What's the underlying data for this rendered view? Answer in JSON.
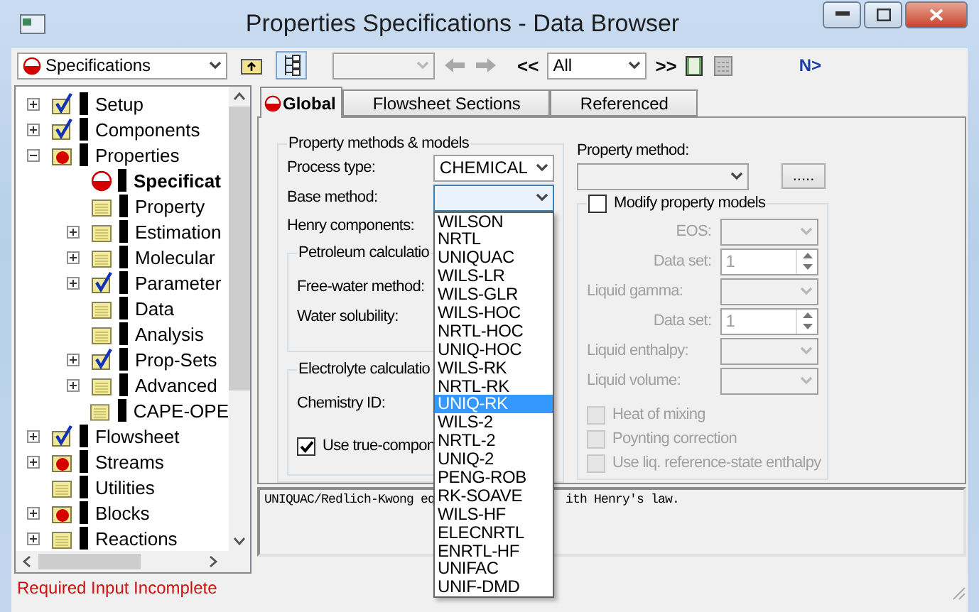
{
  "window": {
    "title": "Properties Specifications - Data Browser"
  },
  "toolbar": {
    "form_select": "Specifications",
    "prev_label": "<<",
    "section_select": "All",
    "next_label": ">>",
    "next_input": "N>"
  },
  "tree": [
    {
      "label": "Setup",
      "kind": "done",
      "expanded": false,
      "selected": false
    },
    {
      "label": "Components",
      "kind": "done",
      "expanded": false,
      "selected": false
    },
    {
      "label": "Properties",
      "kind": "incomplete",
      "expanded": true,
      "selected": false,
      "children": [
        {
          "label": "Specificat",
          "kind": "input",
          "selected": true
        },
        {
          "label": "Property",
          "kind": "empty",
          "selected": false
        },
        {
          "label": "Estimation",
          "kind": "empty",
          "expanded": false,
          "selected": false
        },
        {
          "label": "Molecular",
          "kind": "empty",
          "expanded": false,
          "selected": false
        },
        {
          "label": "Parameter",
          "kind": "done",
          "expanded": false,
          "selected": false
        },
        {
          "label": "Data",
          "kind": "empty",
          "selected": false
        },
        {
          "label": "Analysis",
          "kind": "empty",
          "selected": false
        },
        {
          "label": "Prop-Sets",
          "kind": "done",
          "expanded": false,
          "selected": false
        },
        {
          "label": "Advanced",
          "kind": "empty",
          "expanded": false,
          "selected": false
        },
        {
          "label": "CAPE-OPE",
          "kind": "empty",
          "selected": false
        }
      ]
    },
    {
      "label": "Flowsheet",
      "kind": "done",
      "expanded": false,
      "selected": false
    },
    {
      "label": "Streams",
      "kind": "incomplete",
      "expanded": false,
      "selected": false
    },
    {
      "label": "Utilities",
      "kind": "empty",
      "selected": false
    },
    {
      "label": "Blocks",
      "kind": "incomplete",
      "expanded": false,
      "selected": false
    },
    {
      "label": "Reactions",
      "kind": "empty",
      "expanded": false,
      "selected": false
    }
  ],
  "tree_status": "Required Input Incomplete",
  "tabs": [
    {
      "label": "Global",
      "selected": true,
      "incomplete": true
    },
    {
      "label": "Flowsheet Sections",
      "selected": false,
      "incomplete": false
    },
    {
      "label": "Referenced",
      "selected": false,
      "incomplete": false
    }
  ],
  "methods_group": {
    "title": "Property methods & models",
    "process_type": {
      "label": "Process type:",
      "value": "CHEMICAL"
    },
    "base_method": {
      "label": "Base method:",
      "expanded": true,
      "options": [
        {
          "label": "WILSON",
          "selected": false
        },
        {
          "label": "NRTL",
          "selected": false
        },
        {
          "label": "UNIQUAC",
          "selected": false
        },
        {
          "label": "WILS-LR",
          "selected": false
        },
        {
          "label": "WILS-GLR",
          "selected": false
        },
        {
          "label": "WILS-HOC",
          "selected": false
        },
        {
          "label": "NRTL-HOC",
          "selected": false
        },
        {
          "label": "UNIQ-HOC",
          "selected": false
        },
        {
          "label": "WILS-RK",
          "selected": false
        },
        {
          "label": "NRTL-RK",
          "selected": false
        },
        {
          "label": "UNIQ-RK",
          "selected": true
        },
        {
          "label": "WILS-2",
          "selected": false
        },
        {
          "label": "NRTL-2",
          "selected": false
        },
        {
          "label": "UNIQ-2",
          "selected": false
        },
        {
          "label": "PENG-ROB",
          "selected": false
        },
        {
          "label": "RK-SOAVE",
          "selected": false
        },
        {
          "label": "WILS-HF",
          "selected": false
        },
        {
          "label": "ELECNRTL",
          "selected": false
        },
        {
          "label": "ENRTL-HF",
          "selected": false
        },
        {
          "label": "UNIFAC",
          "selected": false
        },
        {
          "label": "UNIF-DMD",
          "selected": false
        }
      ]
    },
    "henry": {
      "label": "Henry components:"
    },
    "petroleum": {
      "title": "Petroleum calculatio",
      "free_water": "Free-water method:",
      "water_solubility": "Water solubility:"
    },
    "electrolyte": {
      "title": "Electrolyte calculatio",
      "chemistry_id": "Chemistry ID:",
      "true_components": {
        "label": "Use true-compon",
        "checked": true
      }
    }
  },
  "property_method": {
    "label": "Property method:",
    "button": "....."
  },
  "modify": {
    "label": "Modify property models",
    "checked": false,
    "fields": [
      {
        "label": "EOS:",
        "kind": "select"
      },
      {
        "label": "Data set:",
        "kind": "spin",
        "value": "1"
      },
      {
        "label": "Liquid gamma:",
        "kind": "select"
      },
      {
        "label": "Data set:",
        "kind": "spin",
        "value": "1"
      },
      {
        "label": "Liquid enthalpy:",
        "kind": "select"
      },
      {
        "label": "Liquid volume:",
        "kind": "select"
      }
    ],
    "options": [
      {
        "label": "Heat of mixing",
        "checked": false
      },
      {
        "label": "Poynting correction",
        "checked": false
      },
      {
        "label": "Use liq. reference-state enthalpy",
        "checked": false
      }
    ]
  },
  "description": [
    "UNIQUAC/Redlich-Kwong eq",
    "ith Henry's law."
  ]
}
